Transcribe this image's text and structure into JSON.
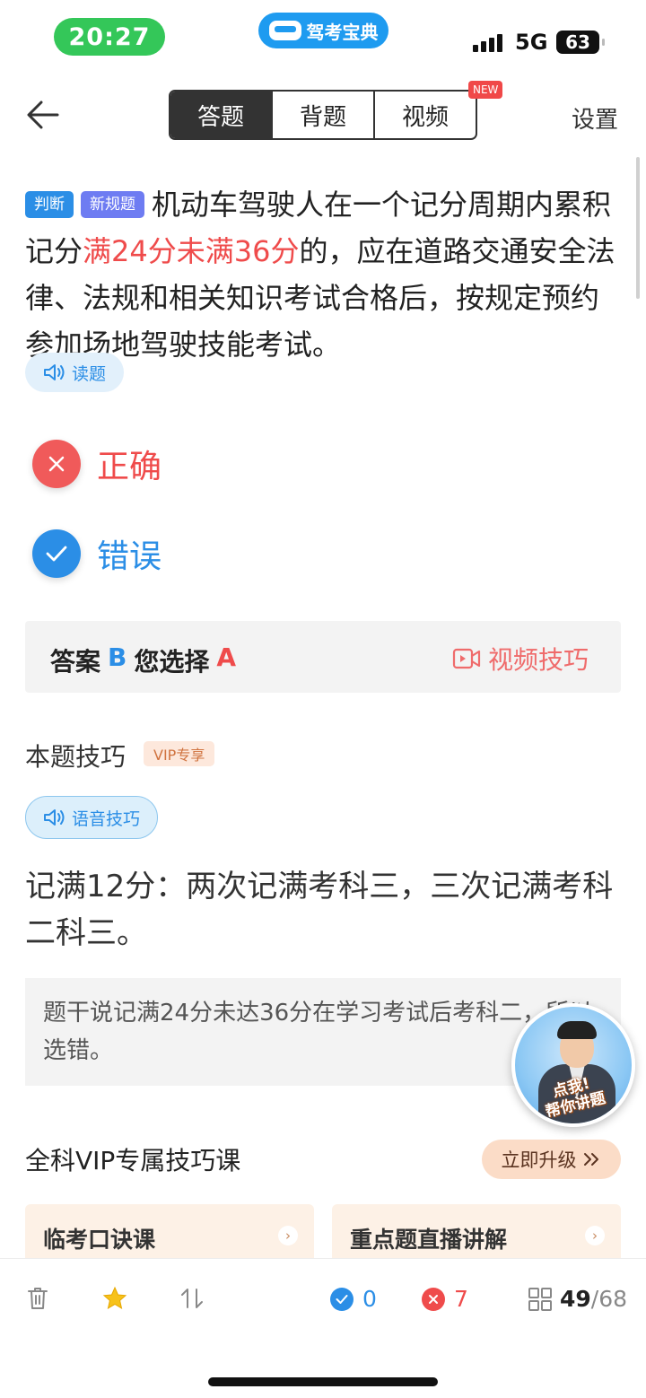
{
  "status_bar": {
    "time": "20:27",
    "app_badge": "驾考宝典",
    "network": "5G",
    "battery": "63"
  },
  "nav": {
    "tabs": [
      "答题",
      "背题",
      "视频"
    ],
    "active_tab": "答题",
    "new_badge": "NEW",
    "settings": "设置"
  },
  "question": {
    "tags": [
      "判断",
      "新规题"
    ],
    "text_part1": "机动车驾驶人在一个记分周期内累积记分",
    "highlight": "满24分未满36分",
    "text_part2": "的，应在道路交通安全法律、法规和相关知识考试合格后，按规定预约参加场地驾驶技能考试。",
    "read_button": "读题"
  },
  "options": [
    {
      "label": "正确",
      "state": "wrong",
      "color": "#f05a5a"
    },
    {
      "label": "错误",
      "state": "correct",
      "color": "#2b8ee6"
    }
  ],
  "answer": {
    "answer_label": "答案",
    "answer_value": "B",
    "chosen_label": "您选择",
    "chosen_value": "A",
    "video_tip": "视频技巧"
  },
  "tips": {
    "title": "本题技巧",
    "vip_tag": "VIP专享",
    "voice_button": "语音技巧",
    "text": "记满12分：两次记满考科三，三次记满考科二科三。",
    "explanation": "题干说记满24分未达36分在学习考试后考科二，所以选错。"
  },
  "teacher_float": {
    "line1": "点我!",
    "line2": "帮你讲题"
  },
  "vip_course": {
    "title": "全科VIP专属技巧课",
    "upgrade_button": "立即升级",
    "cards": [
      "临考口诀课",
      "重点题直播讲解"
    ]
  },
  "bottom_bar": {
    "correct_count": "0",
    "wrong_count": "7",
    "current": "49",
    "total": "/68"
  },
  "colors": {
    "accent_blue": "#2b8ee6",
    "error_red": "#ef4b4b",
    "status_green": "#34c759"
  }
}
